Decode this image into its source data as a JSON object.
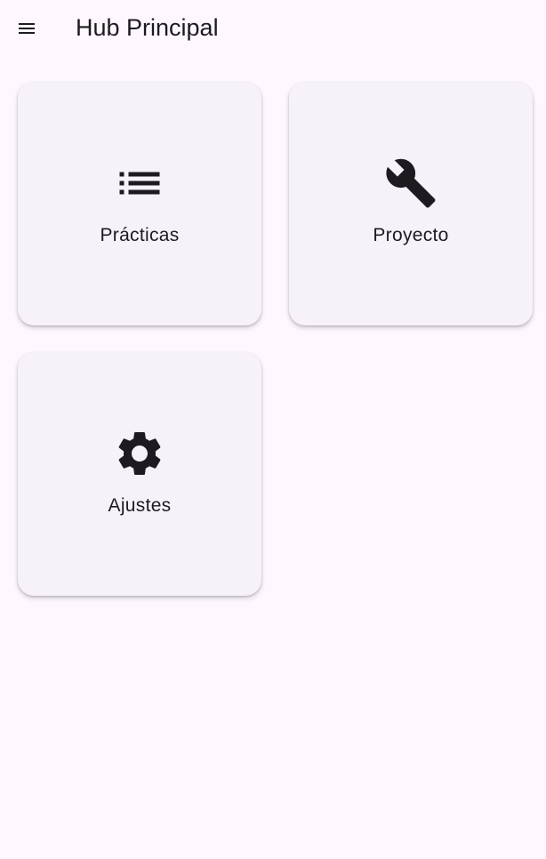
{
  "app_bar": {
    "title": "Hub Principal",
    "menu_icon": "menu-icon"
  },
  "cards": [
    {
      "label": "Prácticas",
      "icon": "list-icon"
    },
    {
      "label": "Proyecto",
      "icon": "wrench-icon"
    },
    {
      "label": "Ajustes",
      "icon": "gear-icon"
    }
  ],
  "colors": {
    "background": "#fef7ff",
    "card_background": "#f7f2fa",
    "text": "#1d1b20",
    "icon": "#1d1b20"
  }
}
